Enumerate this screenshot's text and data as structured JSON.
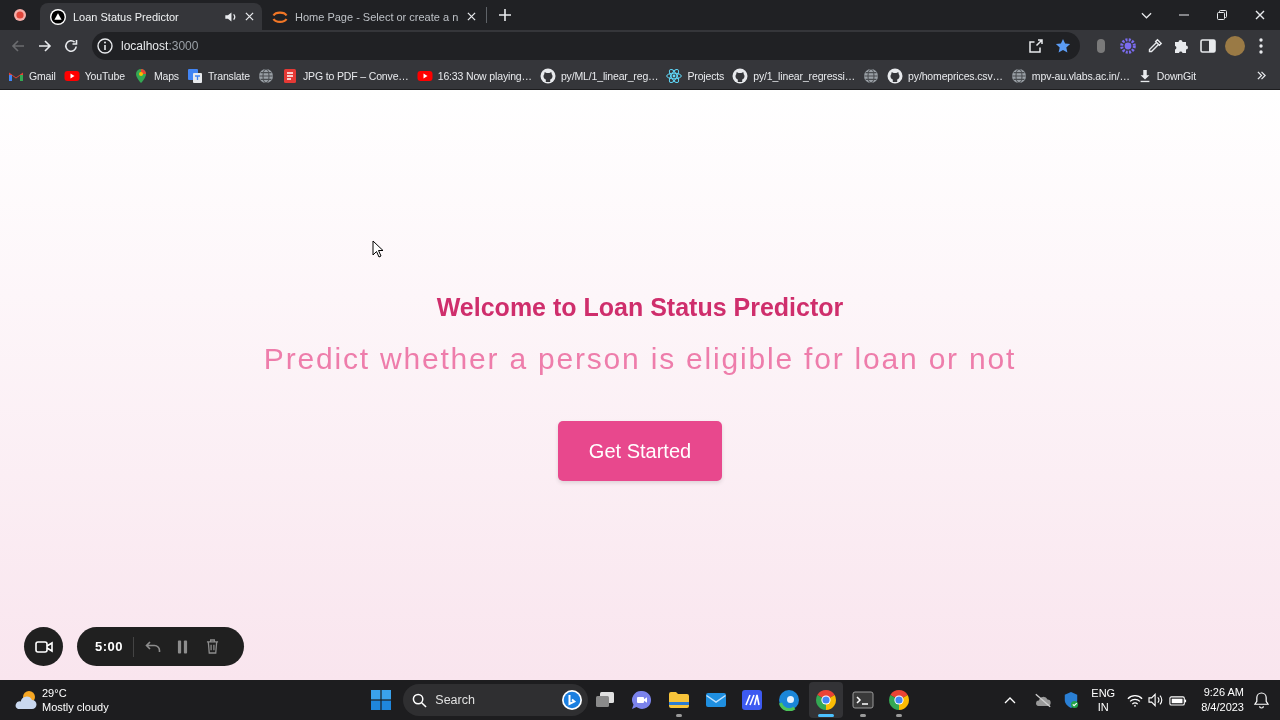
{
  "browser": {
    "tabs": [
      {
        "kind": "site",
        "title": "Loan Status Predictor",
        "selected": true,
        "audio_playing": true
      },
      {
        "kind": "notebook",
        "title": "Home Page - Select or create a n",
        "selected": false,
        "audio_playing": false
      }
    ],
    "back_disabled": true,
    "address": {
      "host": "localhost",
      "port": ":3000"
    },
    "bookmarked": true,
    "bookmarks": [
      {
        "kind": "gmail",
        "label": "Gmail"
      },
      {
        "kind": "youtube",
        "label": "YouTube"
      },
      {
        "kind": "maps",
        "label": "Maps"
      },
      {
        "kind": "translate",
        "label": "Translate"
      },
      {
        "kind": "site"
      },
      {
        "kind": "pdf",
        "label": "JPG to PDF – Conve…"
      },
      {
        "kind": "youtube",
        "label": "16:33 Now playing…"
      },
      {
        "kind": "github",
        "label": "py/ML/1_linear_reg…"
      },
      {
        "kind": "react",
        "label": "Projects"
      },
      {
        "kind": "github",
        "label": "py/1_linear_regressi…"
      },
      {
        "kind": "site"
      },
      {
        "kind": "github",
        "label": "py/homeprices.csv…"
      },
      {
        "kind": "site",
        "label": "mpv-au.vlabs.ac.in/…"
      },
      {
        "kind": "download",
        "label": "DownGit"
      }
    ]
  },
  "page": {
    "heading": "Welcome to Loan Status Predictor",
    "subheading": "Predict whether a person is eligible for loan or not",
    "button": "Get Started"
  },
  "recorder": {
    "timer": "5:00"
  },
  "taskbar": {
    "weather": {
      "temperature": "29°C",
      "condition": "Mostly cloudy"
    },
    "search": {
      "placeholder": "Search"
    },
    "apps": [
      {
        "kind": "taskview",
        "running": false,
        "selected": false
      },
      {
        "kind": "chat",
        "running": false,
        "selected": false
      },
      {
        "kind": "explorer",
        "running": true,
        "selected": false
      },
      {
        "kind": "mail",
        "running": false,
        "selected": false
      },
      {
        "kind": "editor",
        "running": false,
        "selected": false
      },
      {
        "kind": "edge",
        "running": false,
        "selected": false
      },
      {
        "kind": "chrome",
        "running": true,
        "selected": true
      },
      {
        "kind": "terminal",
        "running": true,
        "selected": false
      },
      {
        "kind": "chrome",
        "running": true,
        "selected": false
      }
    ],
    "tray": {
      "language": "ENG",
      "region": "IN",
      "time": "9:26 AM",
      "date": "8/4/2023"
    }
  }
}
